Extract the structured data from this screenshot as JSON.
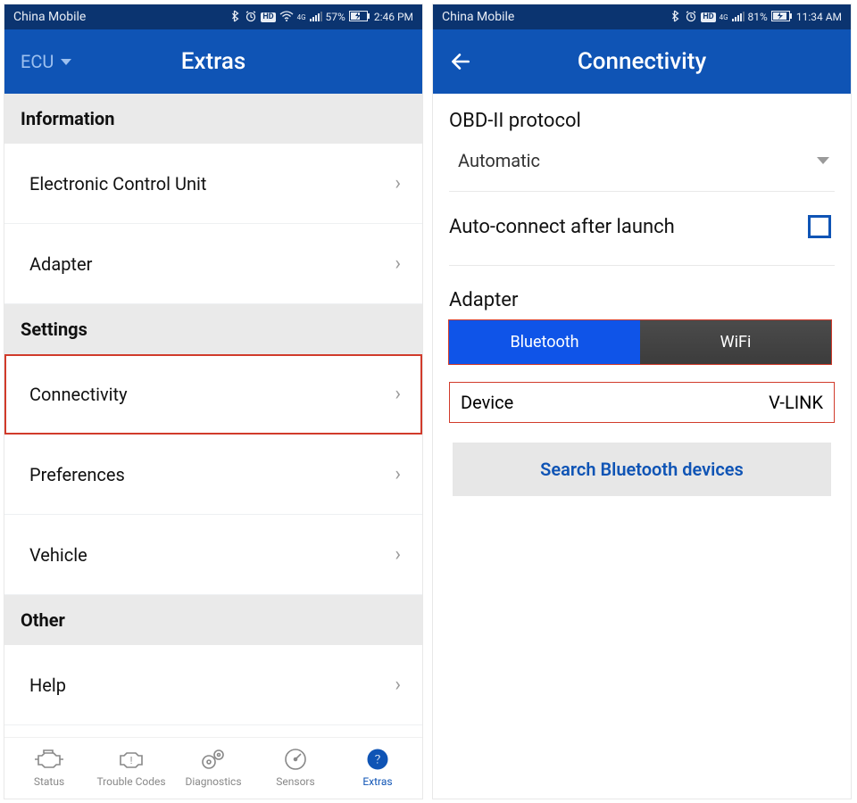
{
  "left": {
    "status": {
      "carrier": "China Mobile",
      "battery": "57%",
      "time": "2:46 PM"
    },
    "appbar": {
      "dropdown_label": "ECU",
      "title": "Extras"
    },
    "sections": [
      {
        "header": "Information",
        "items": [
          {
            "label": "Electronic Control Unit",
            "highlight": false
          },
          {
            "label": "Adapter",
            "highlight": false
          }
        ]
      },
      {
        "header": "Settings",
        "items": [
          {
            "label": "Connectivity",
            "highlight": true
          },
          {
            "label": "Preferences",
            "highlight": false
          },
          {
            "label": "Vehicle",
            "highlight": false
          }
        ]
      },
      {
        "header": "Other",
        "items": [
          {
            "label": "Help",
            "highlight": false
          }
        ]
      }
    ],
    "nav": {
      "items": [
        {
          "label": "Status",
          "active": false
        },
        {
          "label": "Trouble Codes",
          "active": false
        },
        {
          "label": "Diagnostics",
          "active": false
        },
        {
          "label": "Sensors",
          "active": false
        },
        {
          "label": "Extras",
          "active": true
        }
      ]
    }
  },
  "right": {
    "status": {
      "carrier": "China Mobile",
      "battery": "81%",
      "time": "11:34 AM"
    },
    "appbar": {
      "title": "Connectivity"
    },
    "protocol": {
      "label": "OBD-II protocol",
      "value": "Automatic"
    },
    "autoconnect": {
      "label": "Auto-connect after launch",
      "checked": false
    },
    "adapter": {
      "label": "Adapter",
      "options": [
        "Bluetooth",
        "WiFi"
      ],
      "selected": "Bluetooth"
    },
    "device": {
      "label": "Device",
      "value": "V-LINK"
    },
    "search_button": "Search Bluetooth devices"
  }
}
